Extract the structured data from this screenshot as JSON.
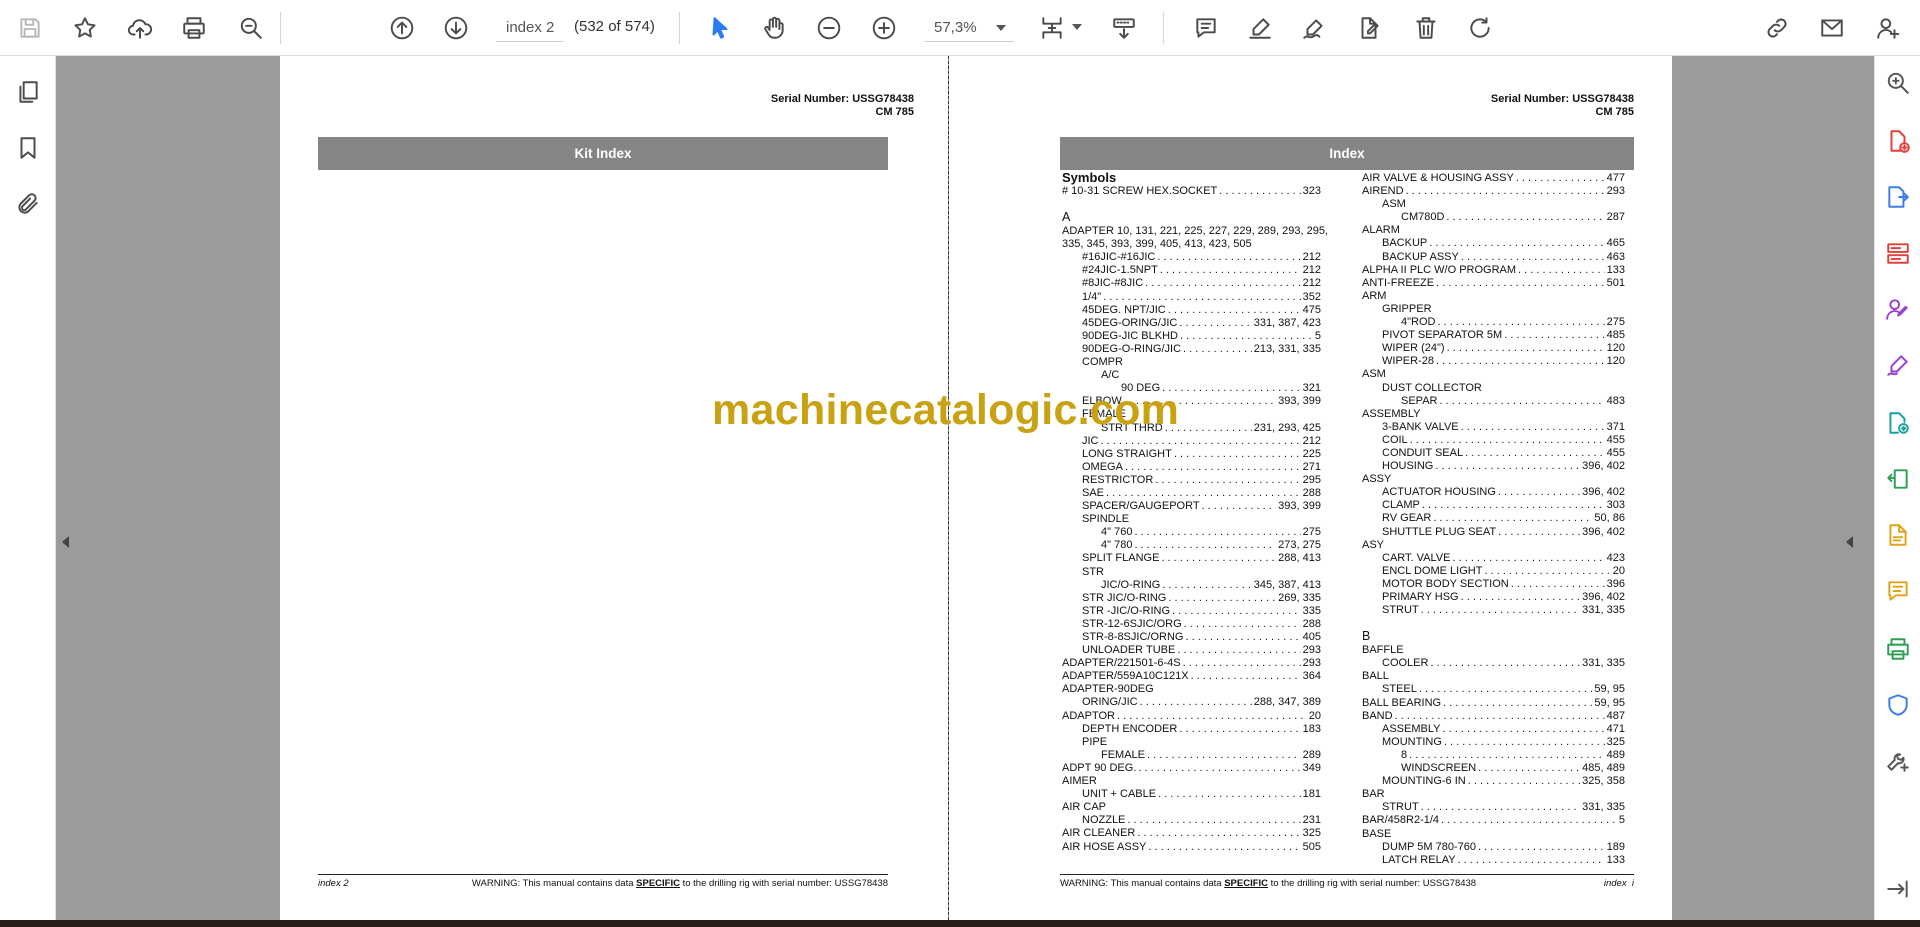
{
  "toolbar": {
    "page_input_value": "index 2",
    "page_count": "(532 of 574)",
    "zoom_value": "57,3%",
    "icons": [
      "save-icon",
      "bookmark-star-icon",
      "upload-cloud-icon",
      "print-icon",
      "zoom-search-icon",
      "previous-page-icon",
      "next-page-icon",
      "select-pointer-icon",
      "hand-pan-icon",
      "zoom-out-icon",
      "zoom-in-icon",
      "fit-page-icon",
      "scroll-mode-icon",
      "comment-icon",
      "highlight-pen-icon",
      "draw-sign-icon",
      "edit-pdf-icon",
      "delete-icon",
      "rotate-icon",
      "share-link-icon",
      "email-icon",
      "add-user-icon"
    ]
  },
  "left_rail": {
    "icons": [
      "pages-thumbnails-icon",
      "bookmarks-icon",
      "attachments-icon"
    ]
  },
  "right_rail": {
    "icons": [
      "search-zoom-icon",
      "create-pdf-icon",
      "export-pdf-icon",
      "organize-pages-icon",
      "request-signature-icon",
      "fill-sign-icon",
      "send-for-review-icon",
      "compress-pdf-icon",
      "export-word-icon",
      "comment-tool-icon",
      "print-production-icon",
      "protect-icon",
      "more-tools-icon",
      "collapse-panel-icon"
    ],
    "colors": [
      "#555555",
      "#e0413d",
      "#3f7ce8",
      "#e0413d",
      "#9b3fd1",
      "#9b3fd1",
      "#1aa0a0",
      "#2e9f54",
      "#e3a21a",
      "#e3a21a",
      "#2e9f54",
      "#3f7ce8",
      "#555555",
      "#555555"
    ]
  },
  "watermark": "machinecatalogic.com",
  "left_page": {
    "serial": "Serial Number: USSG78438",
    "model": "CM 785",
    "band_title": "Kit Index",
    "footer_left": "index 2",
    "footer_warning_pre": "WARNING:  This manual contains data ",
    "footer_warning_specific": "SPECIFIC",
    "footer_warning_post": " to the drilling rig with serial number: USSG78438"
  },
  "right_page": {
    "serial": "Serial Number: USSG78438",
    "model": "CM 785",
    "band_title": "Index",
    "footer_warning_pre": "WARNING:  This manual contains data ",
    "footer_warning_specific": "SPECIFIC",
    "footer_warning_post": " to the drilling rig with serial number: USSG78438",
    "footer_right": "index",
    "footer_right_num": "i",
    "col1": [
      {
        "t": "Symbols",
        "p": "",
        "lvl": 0,
        "kind": "hdr"
      },
      {
        "t": "# 10-31 SCREW HEX.SOCKET",
        "p": "323",
        "lvl": 0
      },
      {
        "t": "A",
        "p": "",
        "lvl": 0,
        "kind": "letter"
      },
      {
        "t": "ADAPTER 10, 131, 221, 225, 227, 229, 289, 293, 295,",
        "p": "",
        "lvl": 0
      },
      {
        "t": "335, 345, 393, 399, 405, 413, 423, 505",
        "p": "",
        "lvl": 0
      },
      {
        "t": "#16JIC-#16JIC",
        "p": "212",
        "lvl": 1
      },
      {
        "t": "#24JIC-1.5NPT",
        "p": "212",
        "lvl": 1
      },
      {
        "t": "#8JIC-#8JIC",
        "p": "212",
        "lvl": 1
      },
      {
        "t": "1/4\"",
        "p": "352",
        "lvl": 1
      },
      {
        "t": "45DEG. NPT/JIC",
        "p": "475",
        "lvl": 1
      },
      {
        "t": "45DEG-ORING/JIC",
        "p": "331, 387, 423",
        "lvl": 1
      },
      {
        "t": "90DEG-JIC BLKHD",
        "p": "5",
        "lvl": 1
      },
      {
        "t": "90DEG-O-RING/JIC",
        "p": "213, 331, 335",
        "lvl": 1
      },
      {
        "t": "COMPR",
        "p": "",
        "lvl": 1
      },
      {
        "t": "A/C",
        "p": "",
        "lvl": 2
      },
      {
        "t": "90 DEG",
        "p": "321",
        "lvl": 3
      },
      {
        "t": "ELBOW",
        "p": "393, 399",
        "lvl": 1
      },
      {
        "t": "FEMALE",
        "p": "",
        "lvl": 1
      },
      {
        "t": "STRT THRD",
        "p": "231, 293, 425",
        "lvl": 2
      },
      {
        "t": "JIC",
        "p": "212",
        "lvl": 1
      },
      {
        "t": "LONG STRAIGHT",
        "p": "225",
        "lvl": 1
      },
      {
        "t": "OMEGA",
        "p": "271",
        "lvl": 1
      },
      {
        "t": "RESTRICTOR",
        "p": "295",
        "lvl": 1
      },
      {
        "t": "SAE",
        "p": "288",
        "lvl": 1
      },
      {
        "t": "SPACER/GAUGEPORT",
        "p": "393, 399",
        "lvl": 1
      },
      {
        "t": "SPINDLE",
        "p": "",
        "lvl": 1
      },
      {
        "t": "4\" 760",
        "p": "275",
        "lvl": 2
      },
      {
        "t": "4\" 780",
        "p": "273, 275",
        "lvl": 2
      },
      {
        "t": "SPLIT FLANGE",
        "p": "288, 413",
        "lvl": 1
      },
      {
        "t": "STR",
        "p": "",
        "lvl": 1
      },
      {
        "t": "JIC/O-RING",
        "p": "345, 387, 413",
        "lvl": 2
      },
      {
        "t": "STR JIC/O-RING",
        "p": "269, 335",
        "lvl": 1
      },
      {
        "t": "STR -JIC/O-RING",
        "p": "335",
        "lvl": 1
      },
      {
        "t": "STR-12-6SJIC/ORG",
        "p": "288",
        "lvl": 1
      },
      {
        "t": "STR-8-8SJIC/ORNG",
        "p": "405",
        "lvl": 1
      },
      {
        "t": "UNLOADER TUBE",
        "p": "293",
        "lvl": 1
      },
      {
        "t": "ADAPTER/221501-6-4S",
        "p": "293",
        "lvl": 0
      },
      {
        "t": "ADAPTER/559A10C121X",
        "p": "364",
        "lvl": 0
      },
      {
        "t": "ADAPTER-90DEG",
        "p": "",
        "lvl": 0
      },
      {
        "t": "ORING/JIC",
        "p": "288, 347, 389",
        "lvl": 1
      },
      {
        "t": "ADAPTOR",
        "p": "20",
        "lvl": 0
      },
      {
        "t": "DEPTH ENCODER",
        "p": "183",
        "lvl": 1
      },
      {
        "t": "PIPE",
        "p": "",
        "lvl": 1
      },
      {
        "t": "FEMALE",
        "p": "289",
        "lvl": 2
      },
      {
        "t": "ADPT 90 DEG.",
        "p": "349",
        "lvl": 0
      },
      {
        "t": "AIMER",
        "p": "",
        "lvl": 0
      },
      {
        "t": "UNIT + CABLE",
        "p": "181",
        "lvl": 1
      },
      {
        "t": "AIR CAP",
        "p": "",
        "lvl": 0
      },
      {
        "t": "NOZZLE",
        "p": "231",
        "lvl": 1
      },
      {
        "t": "AIR CLEANER",
        "p": "325",
        "lvl": 0
      },
      {
        "t": "AIR HOSE ASSY",
        "p": "505",
        "lvl": 0
      }
    ],
    "col2": [
      {
        "t": "AIR VALVE & HOUSING ASSY",
        "p": "477",
        "lvl": 0
      },
      {
        "t": "AIREND",
        "p": "293",
        "lvl": 0
      },
      {
        "t": "ASM",
        "p": "",
        "lvl": 1
      },
      {
        "t": "CM780D",
        "p": "287",
        "lvl": 2
      },
      {
        "t": "ALARM",
        "p": "",
        "lvl": 0
      },
      {
        "t": "BACKUP",
        "p": "465",
        "lvl": 1
      },
      {
        "t": "BACKUP ASSY",
        "p": "463",
        "lvl": 1
      },
      {
        "t": "ALPHA II PLC W/O PROGRAM",
        "p": "133",
        "lvl": 0
      },
      {
        "t": "ANTI-FREEZE",
        "p": "501",
        "lvl": 0
      },
      {
        "t": "ARM",
        "p": "",
        "lvl": 0
      },
      {
        "t": "GRIPPER",
        "p": "",
        "lvl": 1
      },
      {
        "t": "4\"ROD",
        "p": "275",
        "lvl": 2
      },
      {
        "t": "PIVOT SEPARATOR 5M",
        "p": "485",
        "lvl": 1
      },
      {
        "t": "WIPER (24\")",
        "p": "120",
        "lvl": 1
      },
      {
        "t": "WIPER-28",
        "p": "120",
        "lvl": 1
      },
      {
        "t": "ASM",
        "p": "",
        "lvl": 0
      },
      {
        "t": "DUST COLLECTOR",
        "p": "",
        "lvl": 1
      },
      {
        "t": "SEPAR",
        "p": "483",
        "lvl": 2
      },
      {
        "t": "ASSEMBLY",
        "p": "",
        "lvl": 0
      },
      {
        "t": "3-BANK VALVE",
        "p": "371",
        "lvl": 1
      },
      {
        "t": "COIL",
        "p": "455",
        "lvl": 1
      },
      {
        "t": "CONDUIT SEAL",
        "p": "455",
        "lvl": 1
      },
      {
        "t": "HOUSING",
        "p": "396, 402",
        "lvl": 1
      },
      {
        "t": "ASSY",
        "p": "",
        "lvl": 0
      },
      {
        "t": "ACTUATOR HOUSING",
        "p": "396, 402",
        "lvl": 1
      },
      {
        "t": "CLAMP",
        "p": "303",
        "lvl": 1
      },
      {
        "t": "RV GEAR",
        "p": "50, 86",
        "lvl": 1
      },
      {
        "t": "SHUTTLE PLUG SEAT",
        "p": "396, 402",
        "lvl": 1
      },
      {
        "t": "ASY",
        "p": "",
        "lvl": 0
      },
      {
        "t": "CART. VALVE",
        "p": "423",
        "lvl": 1
      },
      {
        "t": "ENCL DOME LIGHT",
        "p": "20",
        "lvl": 1
      },
      {
        "t": "MOTOR BODY SECTION",
        "p": "396",
        "lvl": 1
      },
      {
        "t": "PRIMARY HSG",
        "p": "396, 402",
        "lvl": 1
      },
      {
        "t": "STRUT",
        "p": "331, 335",
        "lvl": 1
      },
      {
        "t": "B",
        "p": "",
        "lvl": 0,
        "kind": "letter"
      },
      {
        "t": "BAFFLE",
        "p": "",
        "lvl": 0
      },
      {
        "t": "COOLER",
        "p": "331, 335",
        "lvl": 1
      },
      {
        "t": "BALL",
        "p": "",
        "lvl": 0
      },
      {
        "t": "STEEL",
        "p": "59, 95",
        "lvl": 1
      },
      {
        "t": "BALL BEARING",
        "p": "59, 95",
        "lvl": 0
      },
      {
        "t": "BAND",
        "p": "487",
        "lvl": 0
      },
      {
        "t": "ASSEMBLY",
        "p": "471",
        "lvl": 1
      },
      {
        "t": "MOUNTING",
        "p": "325",
        "lvl": 1
      },
      {
        "t": "8",
        "p": "489",
        "lvl": 2
      },
      {
        "t": "WINDSCREEN",
        "p": "485, 489",
        "lvl": 2
      },
      {
        "t": "MOUNTING-6 IN",
        "p": "325, 358",
        "lvl": 1
      },
      {
        "t": "BAR",
        "p": "",
        "lvl": 0
      },
      {
        "t": "STRUT",
        "p": "331, 335",
        "lvl": 1
      },
      {
        "t": "BAR/458R2-1/4",
        "p": "5",
        "lvl": 0
      },
      {
        "t": "BASE",
        "p": "",
        "lvl": 0
      },
      {
        "t": "DUMP 5M 780-760",
        "p": "189",
        "lvl": 1
      },
      {
        "t": "LATCH RELAY",
        "p": "133",
        "lvl": 1
      }
    ]
  }
}
